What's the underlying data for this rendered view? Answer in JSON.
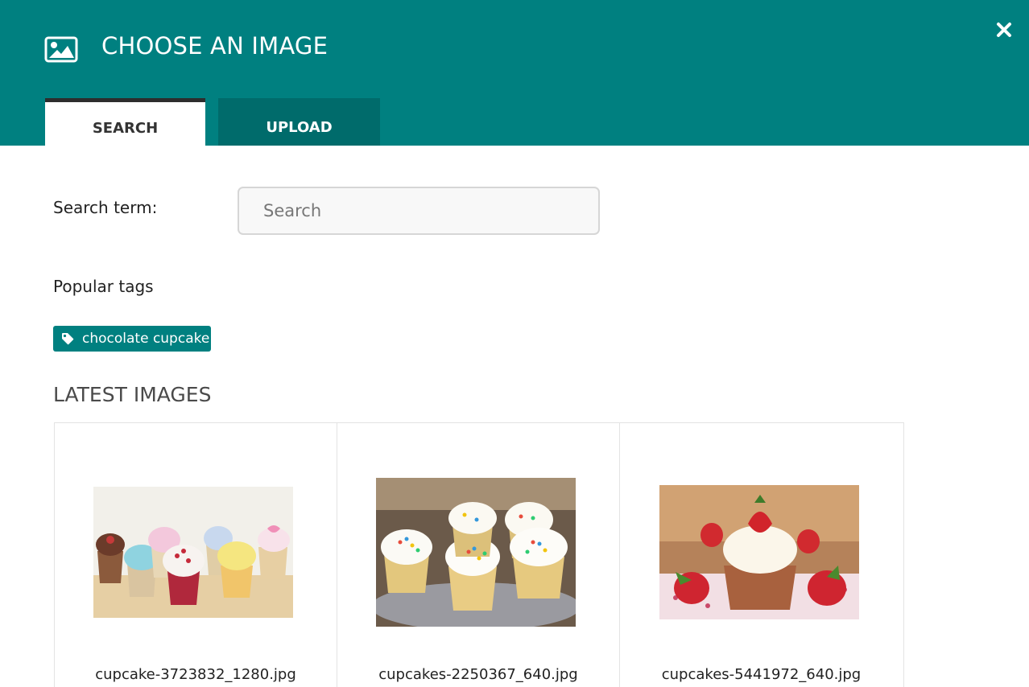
{
  "header": {
    "title": "CHOOSE AN IMAGE",
    "icon": "image-icon",
    "close_icon": "close-icon",
    "background": "#008080"
  },
  "tabs": [
    {
      "label": "SEARCH",
      "active": true
    },
    {
      "label": "UPLOAD",
      "active": false
    }
  ],
  "search": {
    "label": "Search term:",
    "placeholder": "Search",
    "value": ""
  },
  "tags": {
    "label": "Popular tags",
    "items": [
      {
        "label": "chocolate cupcake",
        "icon": "tag-icon"
      }
    ]
  },
  "latest": {
    "title": "LATEST IMAGES",
    "images": [
      {
        "filename": "cupcake-3723832_1280.jpg"
      },
      {
        "filename": "cupcakes-2250367_640.jpg"
      },
      {
        "filename": "cupcakes-5441972_640.jpg"
      }
    ]
  }
}
